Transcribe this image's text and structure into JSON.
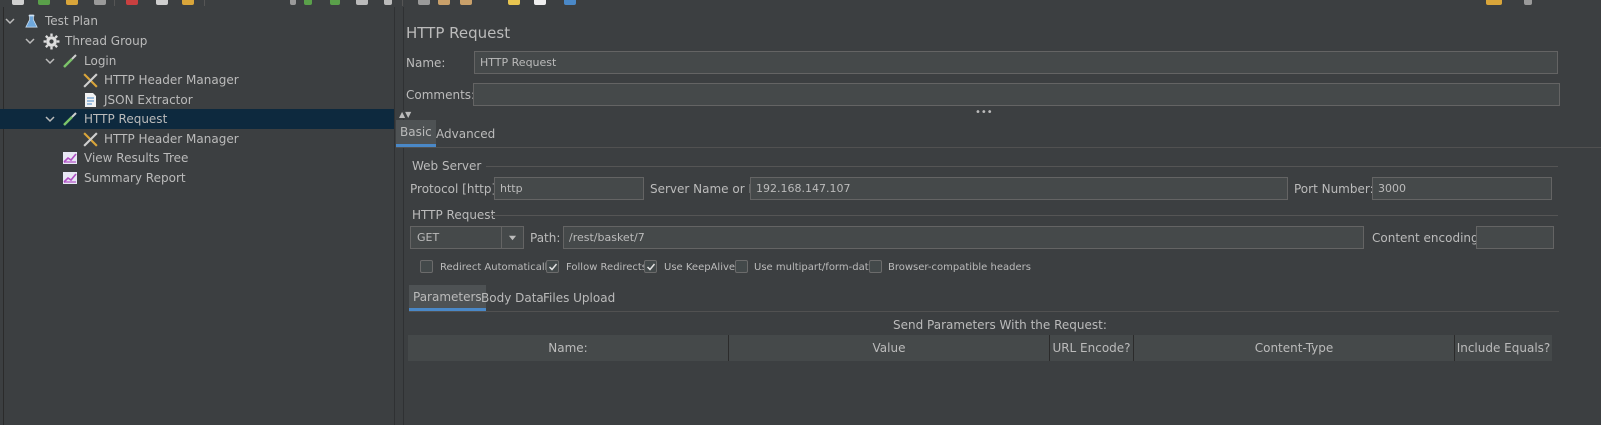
{
  "tree": {
    "items": [
      {
        "label": "Test Plan",
        "icon": "flask-icon"
      },
      {
        "label": "Thread Group",
        "icon": "gear-icon"
      },
      {
        "label": "Login",
        "icon": "pipette-icon"
      },
      {
        "label": "HTTP Header Manager",
        "icon": "tools-icon"
      },
      {
        "label": "JSON Extractor",
        "icon": "document-icon"
      },
      {
        "label": "HTTP Request",
        "icon": "pipette-icon"
      },
      {
        "label": "HTTP Header Manager",
        "icon": "tools-icon"
      },
      {
        "label": "View Results Tree",
        "icon": "chart-icon"
      },
      {
        "label": "Summary Report",
        "icon": "chart-icon"
      }
    ],
    "selected_index": 5
  },
  "sampler": {
    "title": "HTTP Request",
    "name_label": "Name:",
    "name_value": "HTTP Request",
    "comments_label": "Comments:",
    "comments_value": ""
  },
  "tabs": {
    "basic": "Basic",
    "advanced": "Advanced"
  },
  "web_server": {
    "group_title": "Web Server",
    "protocol_label": "Protocol [http]:",
    "protocol_value": "http",
    "server_label": "Server Name or IP:",
    "server_value": "192.168.147.107",
    "port_label": "Port Number:",
    "port_value": "3000"
  },
  "http_request": {
    "group_title": "HTTP Request",
    "method": "GET",
    "path_label": "Path:",
    "path_value": "/rest/basket/7",
    "encoding_label": "Content encoding:",
    "encoding_value": ""
  },
  "options": [
    {
      "label": "Redirect Automatically",
      "checked": false
    },
    {
      "label": "Follow Redirects",
      "checked": true
    },
    {
      "label": "Use KeepAlive",
      "checked": true
    },
    {
      "label": "Use multipart/form-data",
      "checked": false
    },
    {
      "label": "Browser-compatible headers",
      "checked": false
    }
  ],
  "sub_tabs": {
    "parameters": "Parameters",
    "body_data": "Body Data",
    "files_upload": "Files Upload"
  },
  "params_table": {
    "caption": "Send Parameters With the Request:",
    "columns": [
      "Name:",
      "Value",
      "URL Encode?",
      "Content-Type",
      "Include Equals?"
    ]
  },
  "colors": {
    "background": "#3c3f41",
    "selection": "#0d293e",
    "accent": "#4a88c7",
    "field": "#45494a"
  }
}
